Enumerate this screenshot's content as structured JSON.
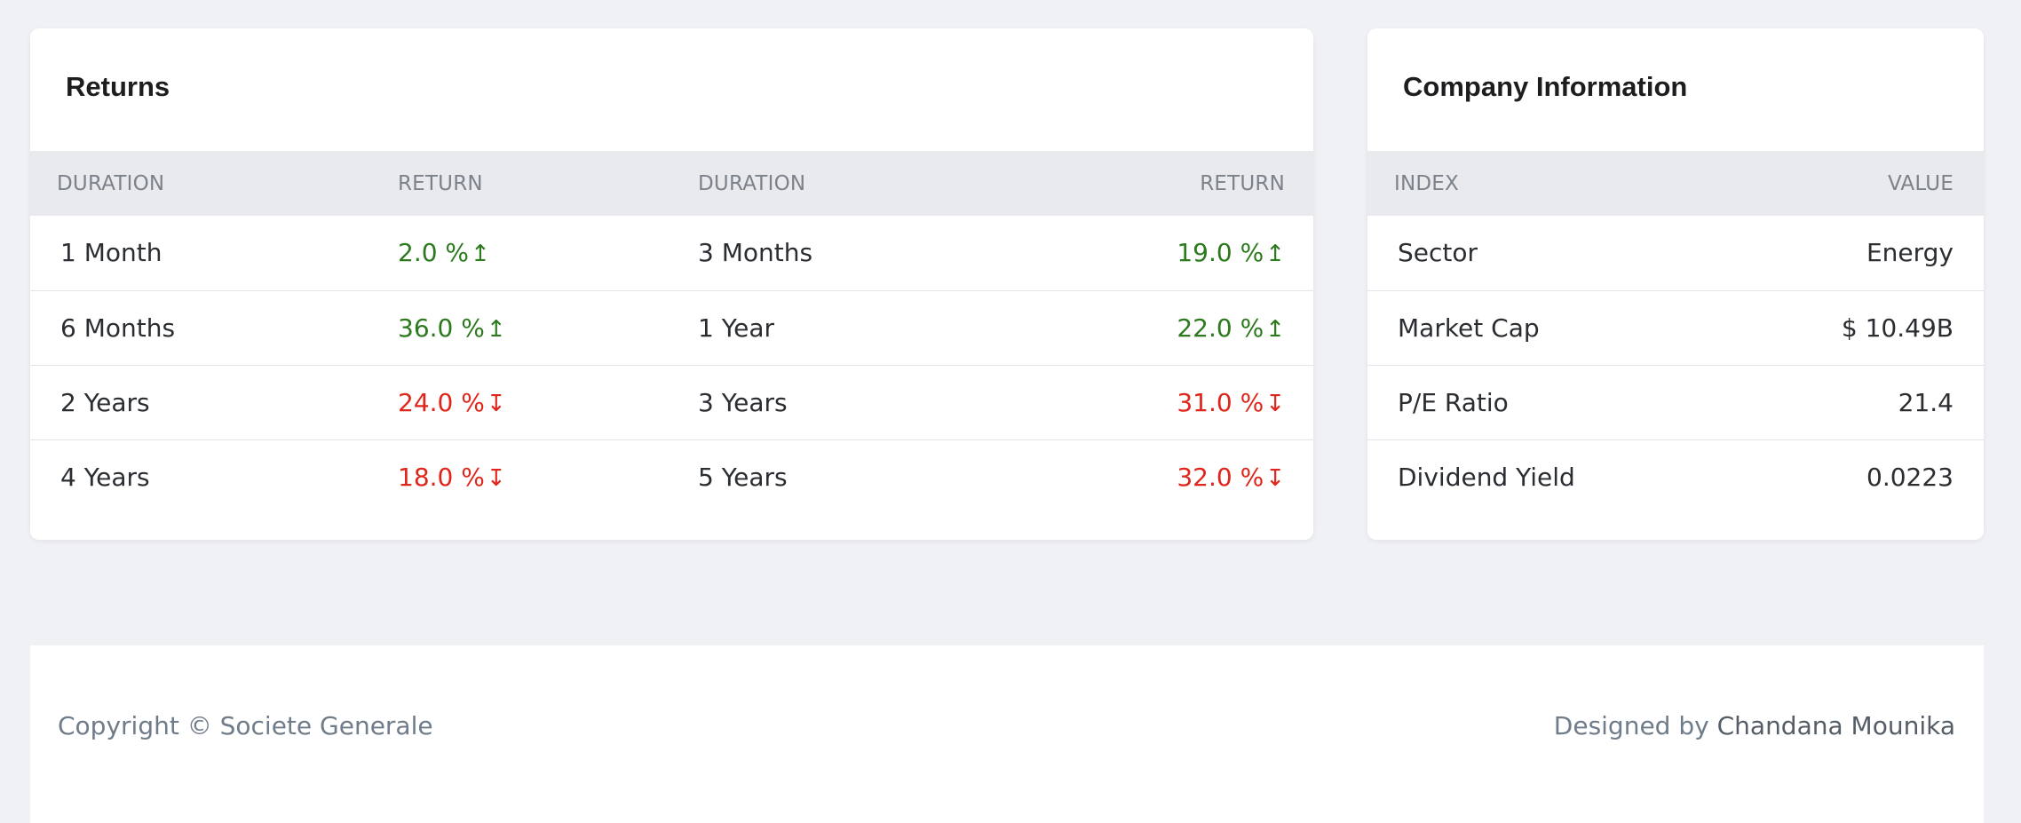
{
  "returns": {
    "title": "Returns",
    "headers": [
      "DURATION",
      "RETURN",
      "DURATION",
      "RETURN"
    ],
    "rows": [
      {
        "d1": "1 Month",
        "r1": "2.0 %",
        "t1": "up",
        "d2": "3 Months",
        "r2": "19.0 %",
        "t2": "up"
      },
      {
        "d1": "6 Months",
        "r1": "36.0 %",
        "t1": "up",
        "d2": "1 Year",
        "r2": "22.0 %",
        "t2": "up"
      },
      {
        "d1": "2 Years",
        "r1": "24.0 %",
        "t1": "down",
        "d2": "3 Years",
        "r2": "31.0 %",
        "t2": "down"
      },
      {
        "d1": "4 Years",
        "r1": "18.0 %",
        "t1": "down",
        "d2": "5 Years",
        "r2": "32.0 %",
        "t2": "down"
      }
    ]
  },
  "company": {
    "title": "Company Information",
    "headers": [
      "INDEX",
      "VALUE"
    ],
    "rows": [
      {
        "index": "Sector",
        "value": "Energy"
      },
      {
        "index": "Market Cap",
        "value": "$ 10.49B"
      },
      {
        "index": "P/E Ratio",
        "value": "21.4"
      },
      {
        "index": "Dividend Yield",
        "value": "0.0223"
      }
    ]
  },
  "footer": {
    "copyright": "Copyright © Societe Generale",
    "designed_by_label": "Designed by",
    "designer": "Chandana Mounika"
  },
  "colors": {
    "up": "#2c7a1e",
    "down": "#e0261b",
    "background": "#f0f1f5"
  },
  "icons": {
    "up": "trend-up-arrow-icon",
    "down": "trend-down-arrow-icon"
  }
}
